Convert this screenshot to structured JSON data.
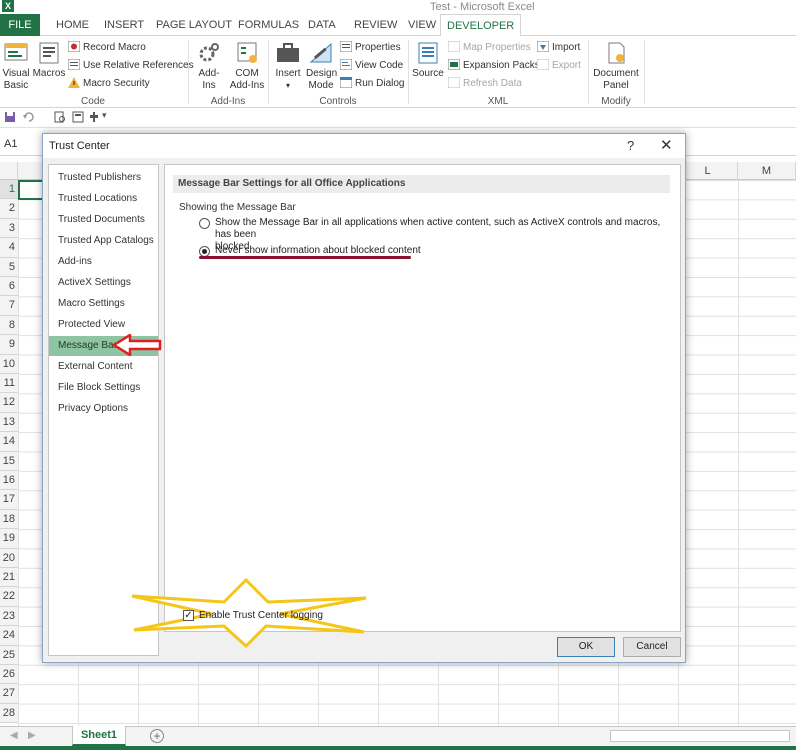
{
  "window": {
    "title": "Test - Microsoft Excel"
  },
  "ribbon_tabs": [
    "FILE",
    "HOME",
    "INSERT",
    "PAGE LAYOUT",
    "FORMULAS",
    "DATA",
    "REVIEW",
    "VIEW",
    "DEVELOPER"
  ],
  "ribbon": {
    "code": {
      "visual_basic": "Visual Basic",
      "macros": "Macros",
      "record_macro": "Record Macro",
      "relative_refs": "Use Relative References",
      "macro_security": "Macro Security",
      "label": "Code"
    },
    "addins": {
      "addins": "Add-Ins",
      "com_addins": "COM Add-Ins",
      "label": "Add-Ins"
    },
    "controls": {
      "insert": "Insert",
      "design_mode": "Design Mode",
      "properties": "Properties",
      "view_code": "View Code",
      "run_dialog": "Run Dialog",
      "label": "Controls"
    },
    "xml": {
      "source": "Source",
      "map_properties": "Map Properties",
      "expansion_packs": "Expansion Packs",
      "refresh_data": "Refresh Data",
      "import": "Import",
      "export": "Export",
      "label": "XML"
    },
    "modify": {
      "document_panel": "Document Panel",
      "label": "Modify"
    }
  },
  "name_box": "A1",
  "grid": {
    "col_headers_visible": [
      "L",
      "M"
    ],
    "row_numbers": [
      "1",
      "2",
      "3",
      "4",
      "5",
      "6",
      "7",
      "8",
      "9",
      "10",
      "11",
      "12",
      "13",
      "14",
      "15",
      "16",
      "17",
      "18",
      "19",
      "20",
      "21",
      "22",
      "23",
      "24",
      "25",
      "26",
      "27",
      "28"
    ]
  },
  "sheet_tab": "Sheet1",
  "dialog": {
    "title": "Trust Center",
    "help": "?",
    "close": "✕",
    "nav_items": [
      "Trusted Publishers",
      "Trusted Locations",
      "Trusted Documents",
      "Trusted App Catalogs",
      "Add-ins",
      "ActiveX Settings",
      "Macro Settings",
      "Protected View",
      "Message Bar",
      "External Content",
      "File Block Settings",
      "Privacy Options"
    ],
    "selected_nav": "Message Bar",
    "section_title": "Message Bar Settings for all Office Applications",
    "subheading": "Showing the Message Bar",
    "option_show_line1": "Show the Message Bar in all applications when active content, such as ActiveX controls and macros, has been",
    "option_show_line2": "blocked",
    "option_never": "Never show information about blocked content",
    "selected_option": "never",
    "logging_label": "Enable Trust Center logging",
    "logging_checked": true,
    "ok": "OK",
    "cancel": "Cancel"
  },
  "colors": {
    "excel_green": "#217346",
    "nav_selected": "#8fc4a2",
    "annotation_red_arrow": "#e02020",
    "annotation_star": "#f5c518",
    "annotation_underline": "#8a1030"
  }
}
